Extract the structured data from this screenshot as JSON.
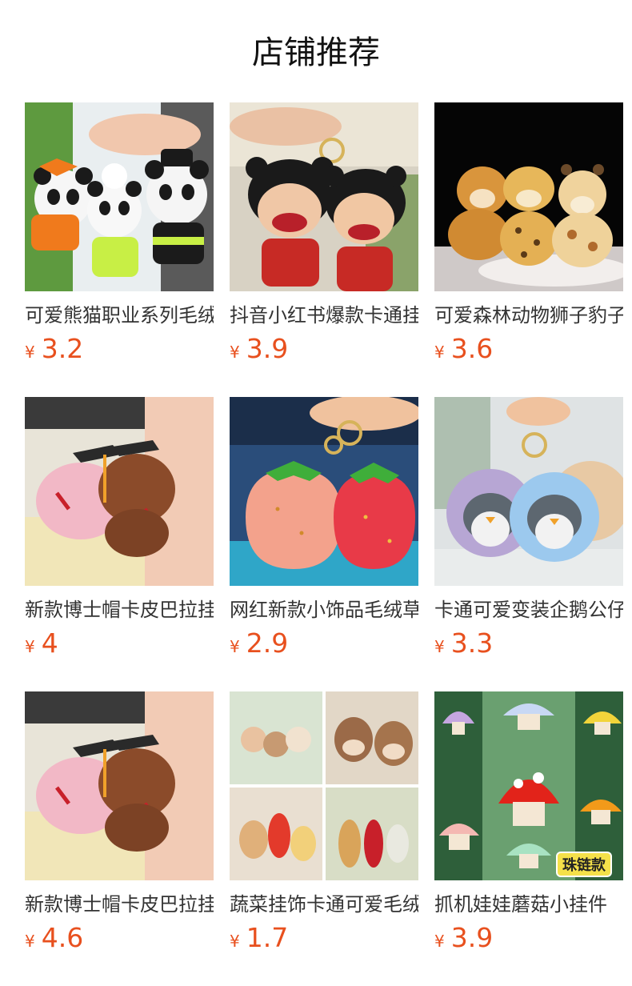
{
  "page": {
    "title": "店铺推荐"
  },
  "products": [
    {
      "name": "可爱熊猫职业系列毛绒挂件",
      "currency": "¥",
      "price": "3.2",
      "image": "panda-keychain-image"
    },
    {
      "name": "抖音小红书爆款卡通挂件",
      "currency": "¥",
      "price": "3.9",
      "image": "cartoon-doll-keychain-image"
    },
    {
      "name": "可爱森林动物狮子豹子挂件",
      "currency": "¥",
      "price": "3.6",
      "image": "forest-animal-plush-image"
    },
    {
      "name": "新款博士帽卡皮巴拉挂件",
      "currency": "¥",
      "price": "4",
      "image": "capybara-doctor-hat-image"
    },
    {
      "name": "网红新款小饰品毛绒草莓",
      "currency": "¥",
      "price": "2.9",
      "image": "strawberry-plush-image"
    },
    {
      "name": "卡通可爱变装企鹅公仔",
      "currency": "¥",
      "price": "3.3",
      "image": "penguin-plush-image"
    },
    {
      "name": "新款博士帽卡皮巴拉挂件",
      "currency": "¥",
      "price": "4.6",
      "image": "capybara-doctor-hat-image"
    },
    {
      "name": "蔬菜挂饰卡通可爱毛绒",
      "currency": "¥",
      "price": "1.7",
      "image": "vegetable-plush-collage-image"
    },
    {
      "name": "抓机娃娃蘑菇小挂件",
      "currency": "¥",
      "price": "3.9",
      "image": "mushroom-plush-collage-image",
      "badge": "珠链款"
    }
  ],
  "colors": {
    "price": "#e8501e",
    "title": "#111111"
  }
}
